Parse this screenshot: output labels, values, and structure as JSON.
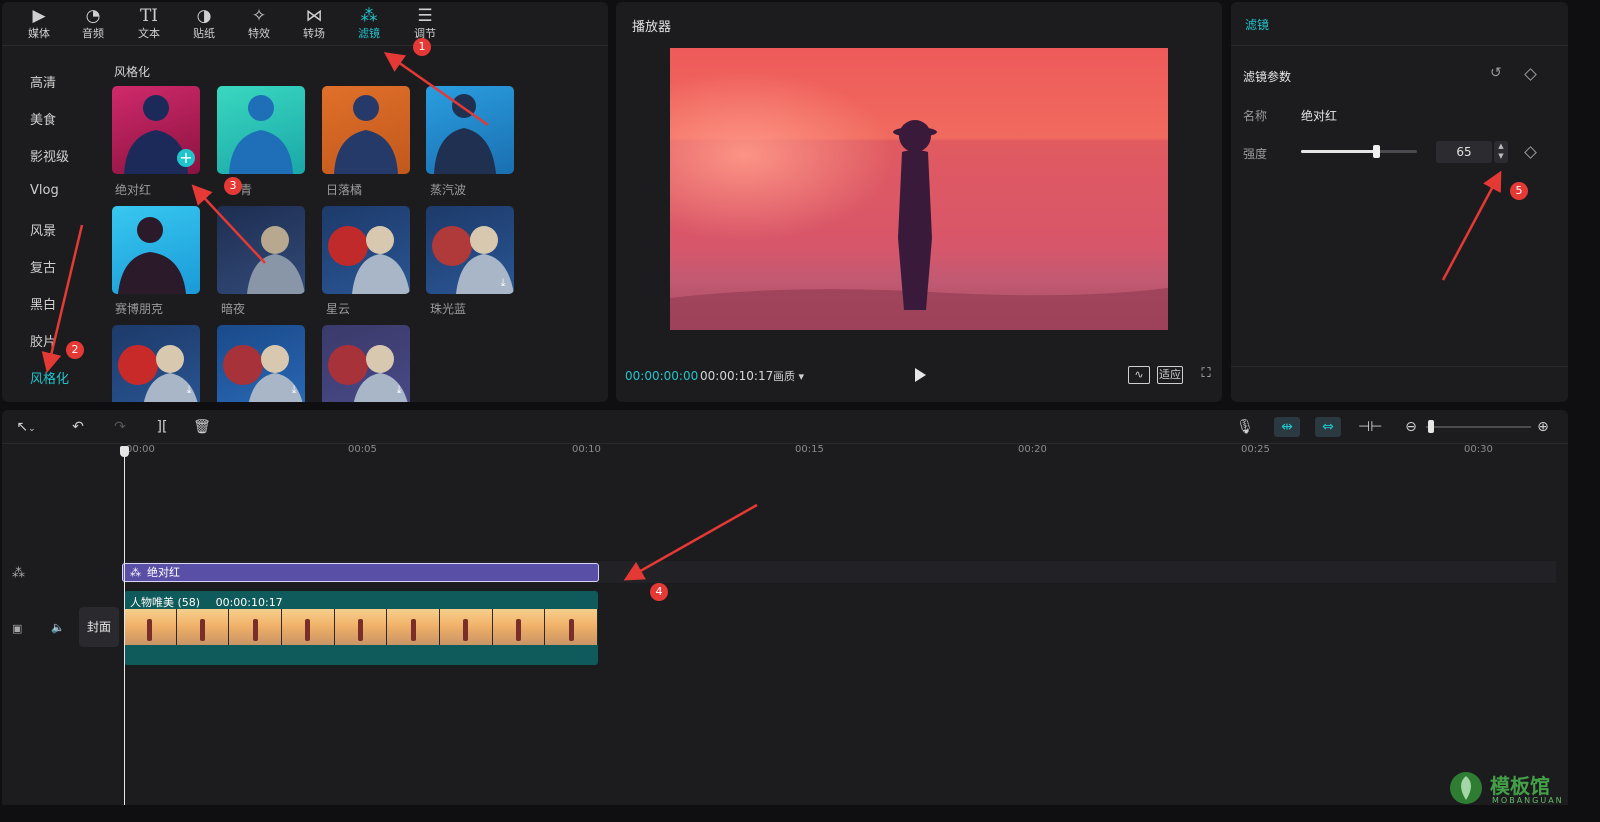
{
  "media": {
    "tabs": [
      {
        "label": "媒体",
        "icon": "media-icon"
      },
      {
        "label": "音频",
        "icon": "audio-icon"
      },
      {
        "label": "文本",
        "icon": "text-icon"
      },
      {
        "label": "贴纸",
        "icon": "sticker-icon"
      },
      {
        "label": "特效",
        "icon": "effects-icon"
      },
      {
        "label": "转场",
        "icon": "transition-icon"
      },
      {
        "label": "滤镜",
        "icon": "filter-icon"
      },
      {
        "label": "调节",
        "icon": "adjust-icon"
      }
    ],
    "active_tab": "滤镜",
    "categories": [
      "高清",
      "美食",
      "影视级",
      "Vlog",
      "风景",
      "复古",
      "黑白",
      "胶片",
      "风格化"
    ],
    "active_category": "风格化",
    "section_title": "风格化",
    "filters": [
      {
        "label": "绝对红"
      },
      {
        "label": "青"
      },
      {
        "label": "日落橘"
      },
      {
        "label": "蒸汽波"
      },
      {
        "label": "赛博朋克"
      },
      {
        "label": "暗夜"
      },
      {
        "label": "星云"
      },
      {
        "label": "珠光蓝"
      }
    ]
  },
  "player": {
    "title": "播放器",
    "current_time": "00:00:00:00",
    "total_time": "00:00:10:17",
    "quality_label": "画质",
    "fit_label": "适应"
  },
  "props": {
    "header": "滤镜",
    "section": "滤镜参数",
    "name_label": "名称",
    "name_value": "绝对红",
    "strength_label": "强度",
    "strength_value": "65"
  },
  "timeline": {
    "ticks": [
      "00:00",
      "00:05",
      "00:10",
      "00:15",
      "00:20",
      "00:25",
      "00:30"
    ],
    "filter_clip_label": "绝对红",
    "video_clip_title": "人物唯美 (58)",
    "video_clip_duration": "00:00:10:17",
    "cover_label": "封面"
  },
  "annotations": [
    "1",
    "2",
    "3",
    "4",
    "5"
  ],
  "watermark": {
    "brand": "模板馆",
    "sub": "MOBANGUAN"
  },
  "colors": {
    "accent": "#22c4cc",
    "filter_clip": "#5a4fa6",
    "video_clip": "#0f5a5a",
    "annotation": "#e53935"
  }
}
